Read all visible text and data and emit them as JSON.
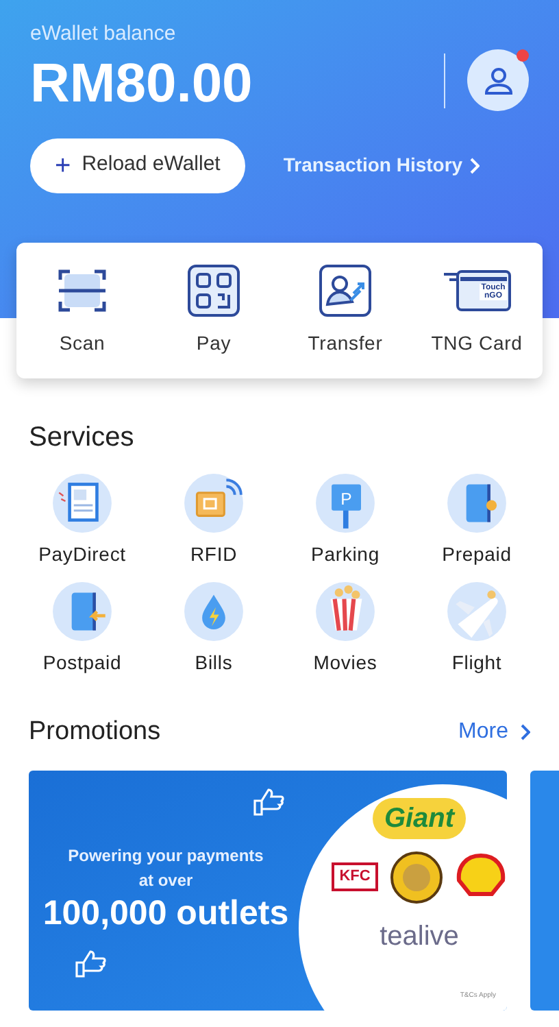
{
  "balance": {
    "label": "eWallet balance",
    "amount": "RM80.00",
    "notification": true
  },
  "actions": {
    "reload": {
      "icon": "+",
      "label": "Reload eWallet"
    },
    "history": {
      "label": "Transaction History"
    }
  },
  "quick_actions": [
    {
      "kind": "scan",
      "label": "Scan"
    },
    {
      "kind": "pay",
      "label": "Pay"
    },
    {
      "kind": "transfer",
      "label": "Transfer"
    },
    {
      "kind": "card",
      "label": "TNG Card",
      "card_text": "Touch\nnGO"
    }
  ],
  "services": {
    "title": "Services",
    "items": [
      {
        "kind": "paydirect",
        "label": "PayDirect"
      },
      {
        "kind": "rfid",
        "label": "RFID"
      },
      {
        "kind": "parking",
        "label": "Parking",
        "sign": "P"
      },
      {
        "kind": "prepaid",
        "label": "Prepaid"
      },
      {
        "kind": "postpaid",
        "label": "Postpaid"
      },
      {
        "kind": "bills",
        "label": "Bills"
      },
      {
        "kind": "movies",
        "label": "Movies"
      },
      {
        "kind": "flight",
        "label": "Flight"
      }
    ]
  },
  "promotions": {
    "title": "Promotions",
    "more": "More",
    "banner": {
      "line_1": "Powering your payments",
      "line_2": "at over",
      "headline": "100,000 outlets",
      "logos": [
        "Giant",
        "KFC",
        "tealive"
      ],
      "fine_print": "T&Cs Apply"
    }
  }
}
